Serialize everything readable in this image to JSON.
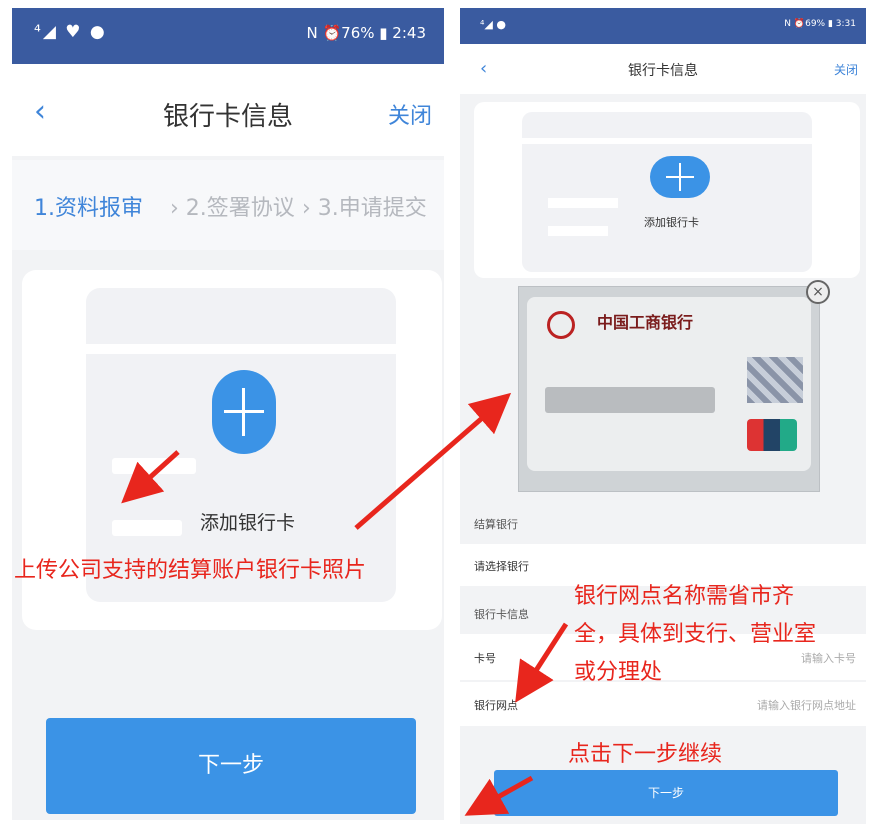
{
  "left": {
    "status_left": "⁴◢ ♥ ●",
    "status_right": "N ⏰76% ▮ 2:43",
    "back": "‹",
    "title": "银行卡信息",
    "close": "关闭",
    "steps": [
      "1.资料报审",
      "› 2.签署协议",
      "› 3.申请提交"
    ],
    "add_label": "添加银行卡",
    "next_label": "下一步"
  },
  "right": {
    "status_left": "⁴◢ ●",
    "status_right": "N ⏰69% ▮ 3:31",
    "back": "‹",
    "title": "银行卡信息",
    "close": "关闭",
    "add_label": "添加银行卡",
    "card_bank": "中国工商银行",
    "card_close": "×",
    "section_settle": "结算银行",
    "select_bank": "请选择银行",
    "section_card_info": "银行卡信息",
    "card_no_label": "卡号",
    "card_no_placeholder": "请输入卡号",
    "branch_label": "银行网点",
    "branch_placeholder": "请输入银行网点地址",
    "next_label": "下一步"
  },
  "annotations": {
    "upload": "上传公司支持的结算账户银行卡照片",
    "branch_line1": "银行网点名称需省市齐",
    "branch_line2": "全，具体到支行、营业室",
    "branch_line3": "或分理处",
    "next": "点击下一步继续"
  },
  "colors": {
    "accent": "#3b93e6",
    "status_bar": "#3a5ba0",
    "annotation": "#e8261d"
  }
}
